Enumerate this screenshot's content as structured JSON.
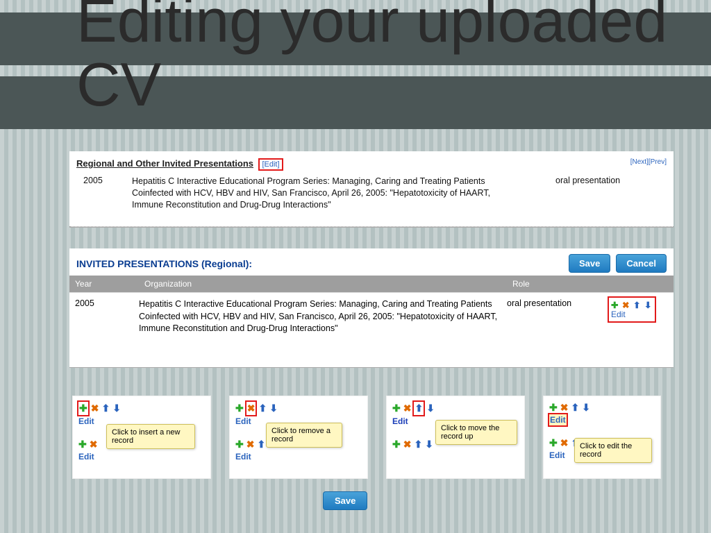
{
  "title": "Editing your uploaded CV",
  "panel1": {
    "section": "Regional and Other Invited Presentations",
    "edit": "[Edit]",
    "next": "[Next]",
    "prev": "[Prev]",
    "year": "2005",
    "desc": "Hepatitis C Interactive Educational Program Series: Managing, Caring and Treating Patients Coinfected with HCV, HBV and HIV, San Francisco, April 26, 2005: \"Hepatotoxicity of HAART, Immune Reconstitution and Drug-Drug Interactions\"",
    "role": "oral presentation"
  },
  "panel2": {
    "title": "INVITED PRESENTATIONS (Regional):",
    "save": "Save",
    "cancel": "Cancel",
    "cols": {
      "year": "Year",
      "org": "Organization",
      "role": "Role"
    },
    "row": {
      "year": "2005",
      "org": "Hepatitis C Interactive Educational Program Series: Managing, Caring and Treating Patients Coinfected with HCV, HBV and HIV, San Francisco, April 26, 2005: \"Hepatotoxicity of HAART, Immune Reconstitution and Drug-Drug Interactions\"",
      "role": "oral presentation",
      "edit": "Edit"
    }
  },
  "callouts": {
    "insert": "Click to insert a new record",
    "remove": "Click to remove a record",
    "moveup": "Click to move the record up",
    "edit": "Click to edit the record",
    "editlabel": "Edit"
  },
  "bottom_save": "Save",
  "icons": {
    "plus": "✚",
    "del": "✖",
    "up": "⬆",
    "down": "⬇"
  }
}
